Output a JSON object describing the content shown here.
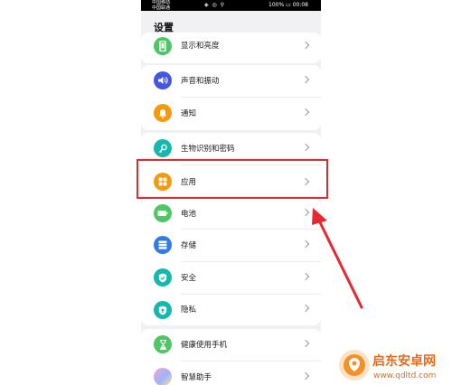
{
  "status_bar": {
    "carrier_1": "中国移动",
    "carrier_2": "中国联通",
    "icons": "◈ ◎ ⚲",
    "battery": "100%",
    "time": "00:08"
  },
  "page_title": "设置",
  "items": {
    "display": "显示和亮度",
    "sound": "声音和振动",
    "notify": "通知",
    "biometric": "生物识别和密码",
    "apps": "应用",
    "battery": "电池",
    "storage": "存储",
    "security": "安全",
    "privacy": "隐私",
    "digital": "健康使用手机",
    "assistant": "智慧助手"
  },
  "icon_colors": {
    "display": "#4cc763",
    "sound": "#4457e0",
    "notify": "#f59a0e",
    "biometric": "#14b8ad",
    "apps": "#f59a0e",
    "battery": "#4cc763",
    "storage": "#2f7be8",
    "security": "#14b8ad",
    "privacy": "#14b8ad",
    "digital": "#4cc763"
  },
  "watermark": {
    "name": "启东安卓网",
    "url": "www.qdltd.com"
  }
}
